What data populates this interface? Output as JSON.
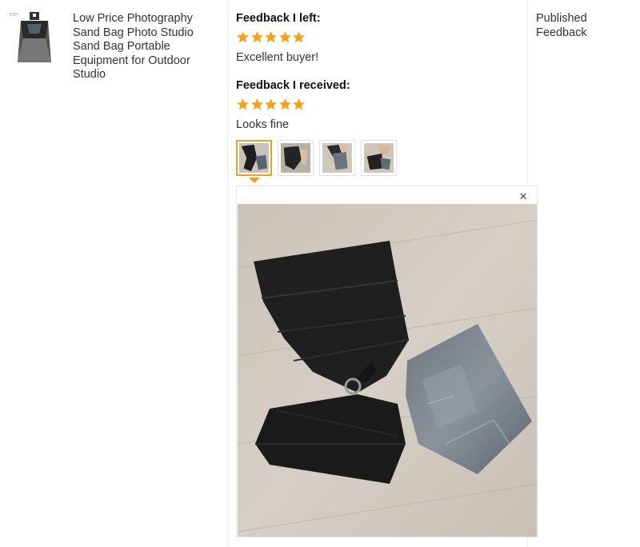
{
  "product": {
    "title": "Low Price Photography Sand Bag Photo Studio Sand Bag Portable Equipment for Outdoor Studio",
    "thumb_icon": "sandbag-product-image",
    "thumb_logo_text": "CY°"
  },
  "feedback_left": {
    "label": "Feedback I left:",
    "rating": 5,
    "text": "Excellent buyer!"
  },
  "feedback_received": {
    "label": "Feedback I received:",
    "rating": 5,
    "text": "Looks fine",
    "photos": [
      "photo-1",
      "photo-2",
      "photo-3",
      "photo-4"
    ],
    "active_photo": 0
  },
  "viewer": {
    "close_icon": "×"
  },
  "status": {
    "text": "Published Feedback"
  },
  "colors": {
    "star": "#f7a21b",
    "active_border": "#f0a020",
    "divider": "#ececec"
  }
}
